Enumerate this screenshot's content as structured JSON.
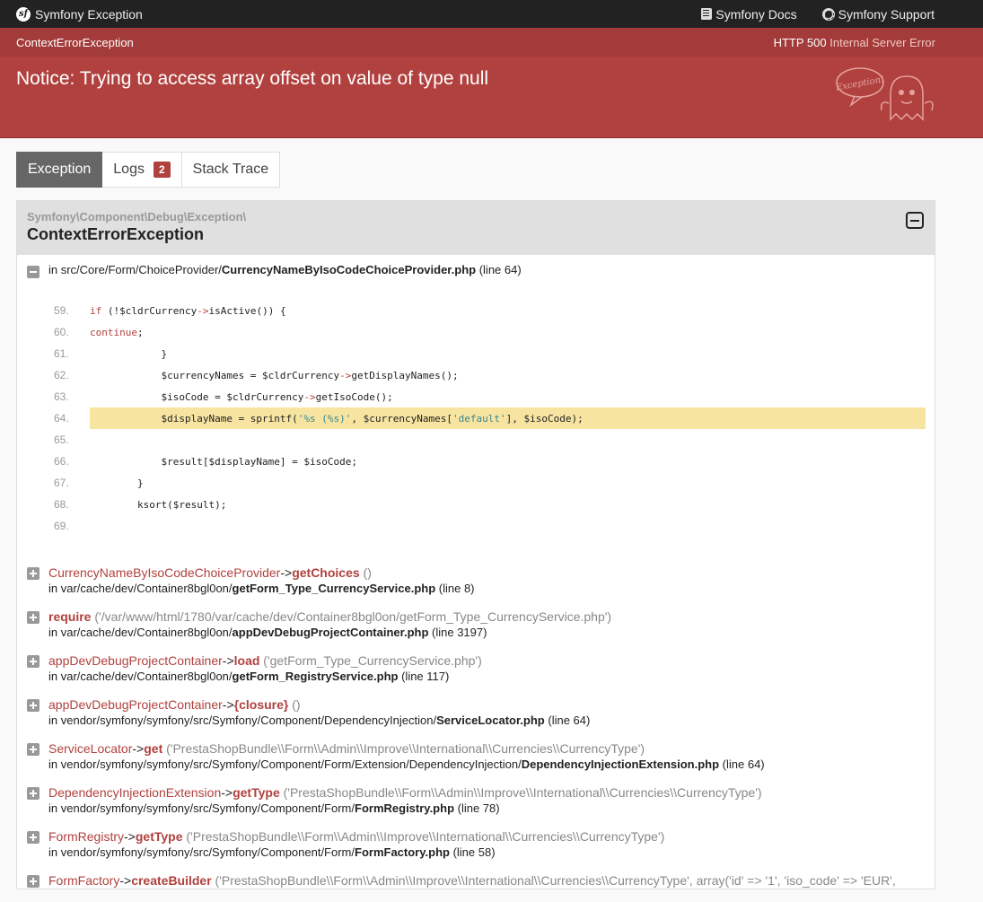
{
  "topbar": {
    "brand": "Symfony Exception",
    "docs_label": "Symfony Docs",
    "support_label": "Symfony Support"
  },
  "header": {
    "class_name": "ContextErrorException",
    "status_code": "HTTP 500",
    "status_text": "Internal Server Error",
    "message": "Notice: Trying to access array offset on value of type null",
    "ghost_text": "Exception!"
  },
  "tabs": [
    {
      "label": "Exception",
      "active": true
    },
    {
      "label": "Logs",
      "badge": "2"
    },
    {
      "label": "Stack Trace"
    }
  ],
  "trace": {
    "namespace": "Symfony\\Component\\Debug\\Exception\\",
    "class": "ContextErrorException",
    "location_prefix": "in src/Core/Form/ChoiceProvider/",
    "location_file": "CurrencyNameByIsoCodeChoiceProvider.php",
    "location_line": "(line 64)",
    "code_lines": [
      {
        "n": "59.",
        "code": "            if (!$cldrCurrency->isActive()) {"
      },
      {
        "n": "60.",
        "code": "                continue;"
      },
      {
        "n": "61.",
        "code": "            }"
      },
      {
        "n": "62.",
        "code": "            $currencyNames = $cldrCurrency->getDisplayNames();"
      },
      {
        "n": "63.",
        "code": "            $isoCode = $cldrCurrency->getIsoCode();"
      },
      {
        "n": "64.",
        "code": "            $displayName = sprintf('%s (%s)', $currencyNames['default'], $isoCode);",
        "highlight": true
      },
      {
        "n": "65.",
        "code": ""
      },
      {
        "n": "66.",
        "code": "            $result[$displayName] = $isoCode;"
      },
      {
        "n": "67.",
        "code": "        }"
      },
      {
        "n": "68.",
        "code": "        ksort($result);"
      },
      {
        "n": "69.",
        "code": ""
      }
    ],
    "calls": [
      {
        "cls": "CurrencyNameByIsoCodeChoiceProvider",
        "arrow": "->",
        "fn": "getChoices",
        "args": "()",
        "loc_prefix": "in var/cache/dev/Container8bgl0on/",
        "loc_file": "getForm_Type_CurrencyService.php",
        "loc_line": "(line 8)"
      },
      {
        "cls": "",
        "arrow": "",
        "fn": "require",
        "args": "('/var/www/html/1780/var/cache/dev/Container8bgl0on/getForm_Type_CurrencyService.php')",
        "loc_prefix": "in var/cache/dev/Container8bgl0on/",
        "loc_file": "appDevDebugProjectContainer.php",
        "loc_line": "(line 3197)"
      },
      {
        "cls": "appDevDebugProjectContainer",
        "arrow": "->",
        "fn": "load",
        "args": "('getForm_Type_CurrencyService.php')",
        "loc_prefix": "in var/cache/dev/Container8bgl0on/",
        "loc_file": "getForm_RegistryService.php",
        "loc_line": "(line 117)"
      },
      {
        "cls": "appDevDebugProjectContainer",
        "arrow": "->",
        "fn": "{closure}",
        "args": "()",
        "loc_prefix": "in vendor/symfony/symfony/src/Symfony/Component/DependencyInjection/",
        "loc_file": "ServiceLocator.php",
        "loc_line": "(line 64)"
      },
      {
        "cls": "ServiceLocator",
        "arrow": "->",
        "fn": "get",
        "args": "('PrestaShopBundle\\\\Form\\\\Admin\\\\Improve\\\\International\\\\Currencies\\\\CurrencyType')",
        "loc_prefix": "in vendor/symfony/symfony/src/Symfony/Component/Form/Extension/DependencyInjection/",
        "loc_file": "DependencyInjectionExtension.php",
        "loc_line": "(line 64)"
      },
      {
        "cls": "DependencyInjectionExtension",
        "arrow": "->",
        "fn": "getType",
        "args": "('PrestaShopBundle\\\\Form\\\\Admin\\\\Improve\\\\International\\\\Currencies\\\\CurrencyType')",
        "loc_prefix": "in vendor/symfony/symfony/src/Symfony/Component/Form/",
        "loc_file": "FormRegistry.php",
        "loc_line": "(line 78)"
      },
      {
        "cls": "FormRegistry",
        "arrow": "->",
        "fn": "getType",
        "args": "('PrestaShopBundle\\\\Form\\\\Admin\\\\Improve\\\\International\\\\Currencies\\\\CurrencyType')",
        "loc_prefix": "in vendor/symfony/symfony/src/Symfony/Component/Form/",
        "loc_file": "FormFactory.php",
        "loc_line": "(line 58)"
      },
      {
        "cls": "FormFactory",
        "arrow": "->",
        "fn": "createBuilder",
        "args": "('PrestaShopBundle\\\\Form\\\\Admin\\\\Improve\\\\International\\\\Currencies\\\\CurrencyType', array('id' => '1', 'iso_code' => 'EUR',",
        "loc_prefix": "",
        "loc_file": "",
        "loc_line": ""
      }
    ]
  }
}
